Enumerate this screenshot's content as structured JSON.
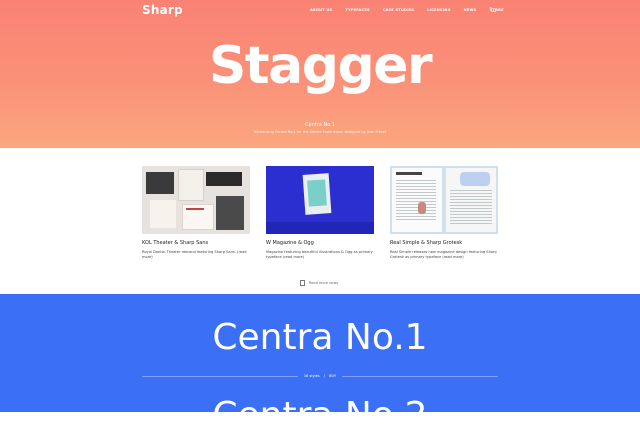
{
  "header": {
    "logo": "Sharp",
    "nav": [
      "ABOUT US",
      "TYPEFACES",
      "CASE STUDIES",
      "LICENSING",
      "NEWS",
      "STORE"
    ]
  },
  "hero": {
    "title": "Stagger",
    "credit_line1": "Centra No.1",
    "credit_line2": "Introducing Centra No.1 for the Centra Experience, designed by Jean Fréset"
  },
  "cards": [
    {
      "title": "KOL Theater & Sharp Sans",
      "desc": "Royal Danish Theater rebrand featuring Sharp Sans. (read more)"
    },
    {
      "title": "W Magazine & Ogg",
      "desc": "Magazine featuring beautiful illustrations & Ogg as primary typeface (read more)"
    },
    {
      "title": "Real Simple & Sharp Grotesk",
      "desc": "Real Simple releases new magazine design featuring Sharp Grotesk as primary typeface (read more)"
    }
  ],
  "more_link": "Read more news",
  "font_section": {
    "name": "Centra No.1",
    "styles": "16 styles",
    "buy": "BUY",
    "separator": "/",
    "next_name": "Centra No.2"
  },
  "colors": {
    "hero_top": "#fa8274",
    "hero_bottom": "#fba77e",
    "blue": "#3b6ff6"
  }
}
